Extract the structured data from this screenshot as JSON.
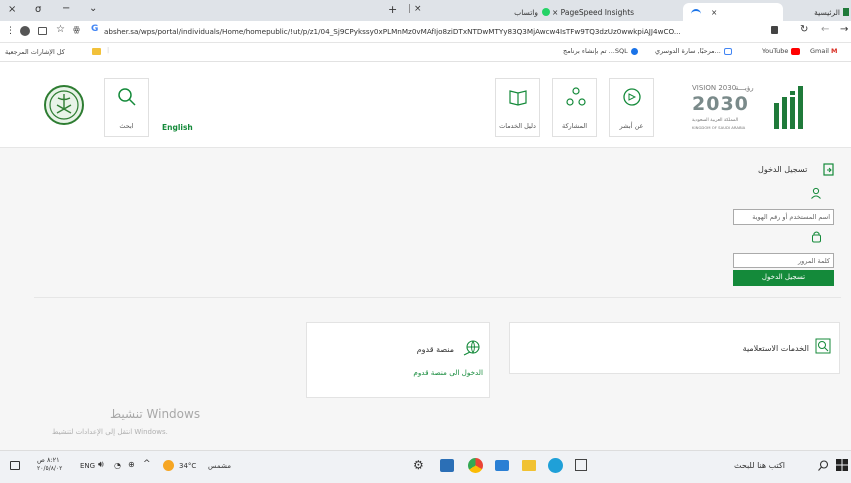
{
  "browser": {
    "window_controls": {
      "close": "×",
      "restore": "σ",
      "minimize": "−",
      "menu": "⌄"
    },
    "new_tab": "+",
    "tabs": [
      {
        "label": "× PageSpeed Insights"
      },
      {
        "label": "واتساب",
        "close": "×"
      },
      {
        "label": "×",
        "active": true
      },
      {
        "label": "الرئيسية"
      }
    ],
    "url": "absher.sa/wps/portal/individuals/Home/homepublic/!ut/p/z1/04_Sj9CPykssy0xPLMnMz0vMAfIjo8ziDTxNTDwMTYy83Q3MjAwcw4IsTFw9TQ3dzUz0wwkpiAJJ4wCO...",
    "bookmarks": [
      {
        "label": "Gmail"
      },
      {
        "label": "YouTube"
      },
      {
        "label": "مرحبًا, سارة الدوسري..."
      },
      {
        "label": "تم بإنشاء برنامج ...SQL"
      }
    ],
    "bookmarks_all": "كل الإشارات المرجعية"
  },
  "header": {
    "vision": "VISION 2030",
    "vision_ar": "رؤيـــة",
    "vision_sub": "المملكة العربية السعودية",
    "vision_sub_en": "KINGDOM OF SAUDI ARABIA",
    "about": "عن أبشر",
    "participation": "المشاركة",
    "guide": "دليل الخدمات",
    "english": "English",
    "search": "ابحث"
  },
  "login": {
    "title": "تسجيل الدخول",
    "username_placeholder": "اسم المستخدم أو رقم الهوية",
    "password_placeholder": "كلمة المرور",
    "submit": "تسجيل الدخول"
  },
  "cards": {
    "inquiry_title": "الخدمات الاستعلامية",
    "qudoom_title": "منصة قدوم",
    "qudoom_link": "الدخول الى منصة قدوم"
  },
  "watermark": {
    "title": "تنشيط Windows",
    "subtitle": "انتقل إلى الإعدادات لتنشيط Windows."
  },
  "taskbar": {
    "search": "اكتب هنا للبحث",
    "weather": "34°C",
    "weather_text": "مشمس",
    "lang": "ENG",
    "time": "٨:٢١ ص",
    "date": "٢٠/٥/٨/٠٢"
  },
  "colors": {
    "brand_green": "#148a3a"
  }
}
